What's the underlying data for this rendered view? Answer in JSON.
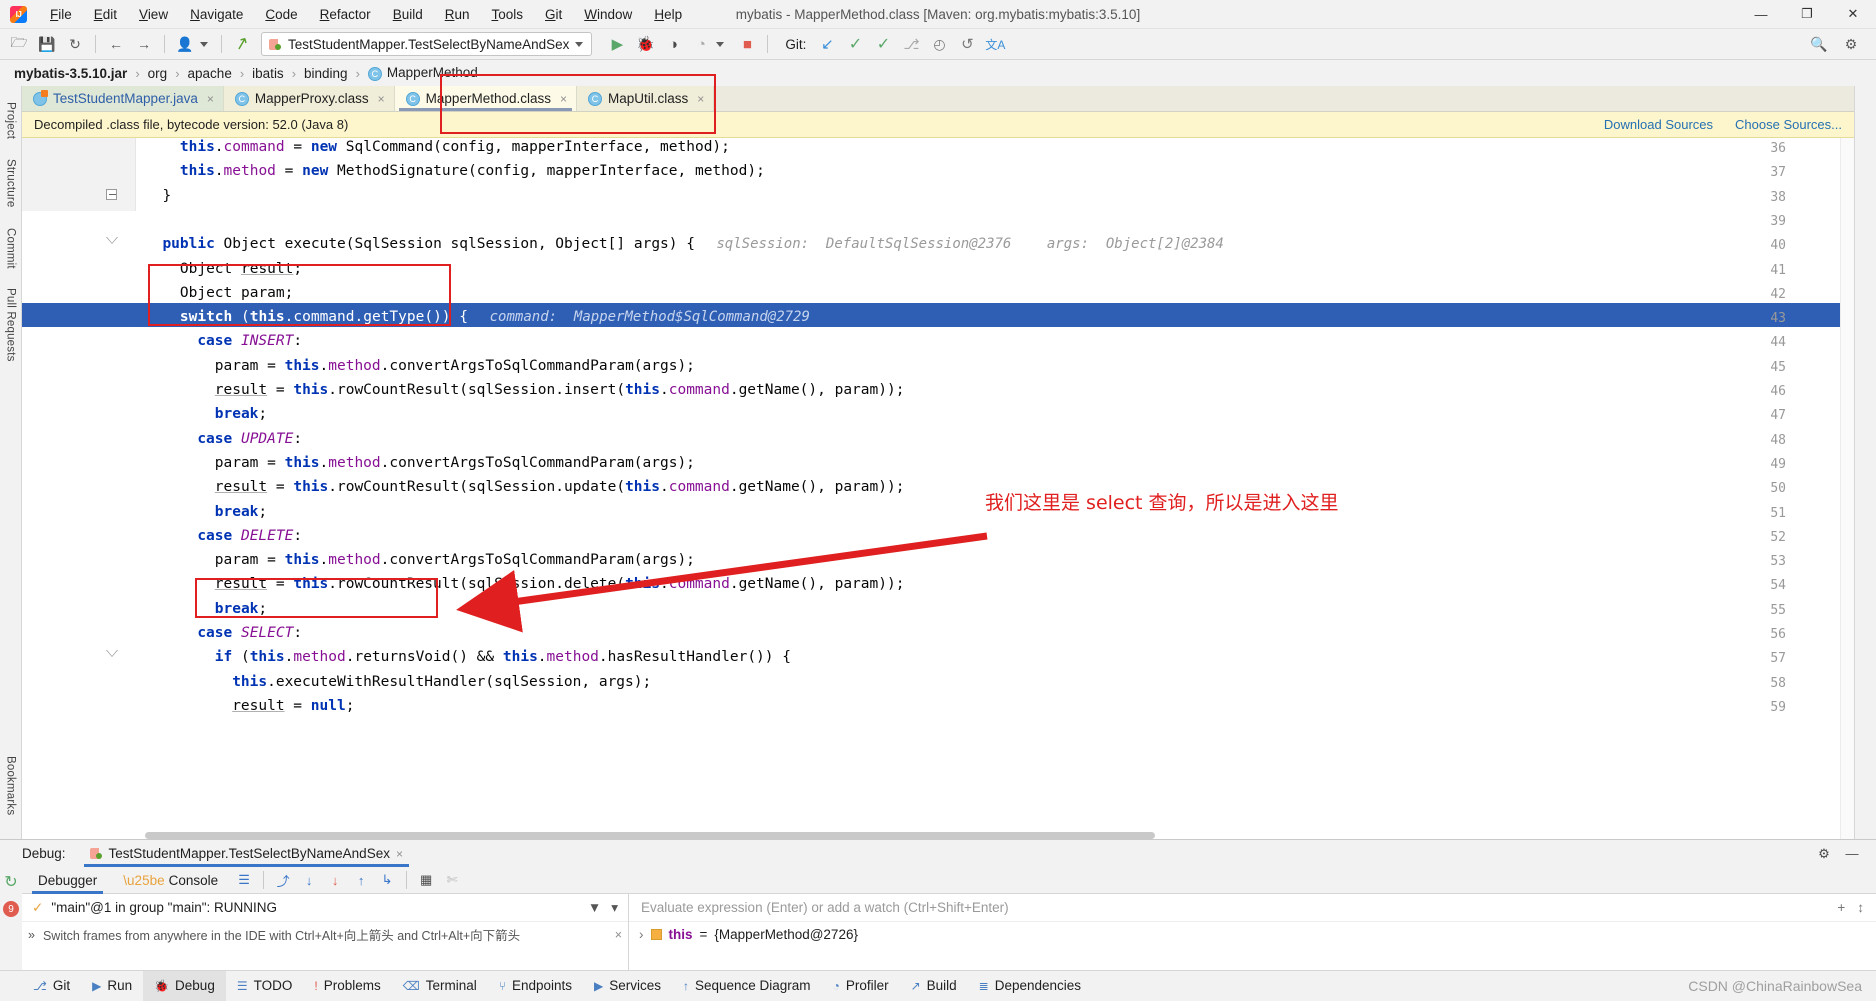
{
  "window": {
    "title": "mybatis - MapperMethod.class [Maven: org.mybatis:mybatis:3.5.10]",
    "minimize": "—",
    "maximize": "❐",
    "close": "✕",
    "app_logo_name": "intellij-idea-logo"
  },
  "menubar": [
    {
      "label": "File"
    },
    {
      "label": "Edit"
    },
    {
      "label": "View"
    },
    {
      "label": "Navigate"
    },
    {
      "label": "Code"
    },
    {
      "label": "Refactor"
    },
    {
      "label": "Build"
    },
    {
      "label": "Run"
    },
    {
      "label": "Tools"
    },
    {
      "label": "Git"
    },
    {
      "label": "Window"
    },
    {
      "label": "Help"
    }
  ],
  "toolbar": {
    "icons_left": [
      {
        "name": "open-folder-icon",
        "glyph": "🗁"
      },
      {
        "name": "save-all-icon",
        "glyph": "💾"
      },
      {
        "name": "sync-refresh-icon",
        "glyph": "↻"
      },
      {
        "name": "back-arrow-icon",
        "glyph": "←"
      },
      {
        "name": "forward-arrow-icon",
        "glyph": "→"
      },
      {
        "name": "profile-user-icon",
        "glyph": "👤"
      },
      {
        "name": "build-hammer-icon",
        "glyph": "↗"
      }
    ],
    "run_config": {
      "label": "TestStudentMapper.TestSelectByNameAndSex",
      "dropdown": "▾"
    },
    "run_button": "▶",
    "debug_button": "🐞",
    "coverage_button": "◑",
    "profile_button": "◔",
    "stop_button": "■",
    "git_label": "Git:",
    "git_update": "↙",
    "git_commit": "✓",
    "git_push": "✓",
    "git_branch": "⎇",
    "git_history": "◴",
    "git_revert": "↺",
    "translate_icon": "文A",
    "search_icon": "🔍",
    "settings_icon": "⚙"
  },
  "breadcrumb": {
    "separator": "›",
    "items": [
      {
        "label": "mybatis-3.5.10.jar",
        "root": true
      },
      {
        "label": "org"
      },
      {
        "label": "apache"
      },
      {
        "label": "ibatis"
      },
      {
        "label": "binding"
      },
      {
        "label": "MapperMethod",
        "badge": "C"
      }
    ]
  },
  "rails": {
    "left": [
      {
        "label": "Project",
        "name": "tool-window-project"
      },
      {
        "label": "Structure",
        "name": "tool-window-structure"
      },
      {
        "label": "Commit",
        "name": "tool-window-commit"
      },
      {
        "label": "Pull Requests",
        "name": "tool-window-pull-requests"
      },
      {
        "label": "Bookmarks",
        "name": "tool-window-bookmarks"
      }
    ]
  },
  "editor_tabs": [
    {
      "label": "TestStudentMapper.java",
      "icon": "java-file-icon",
      "close": "×",
      "active": false,
      "kind": "java"
    },
    {
      "label": "MapperProxy.class",
      "icon": "class-file-icon",
      "close": "×",
      "active": false,
      "kind": "cls"
    },
    {
      "label": "MapperMethod.class",
      "icon": "class-file-icon",
      "close": "×",
      "active": true,
      "kind": "cls"
    },
    {
      "label": "MapUtil.class",
      "icon": "class-file-icon",
      "close": "×",
      "active": false,
      "kind": "cls"
    }
  ],
  "notification": {
    "text": "Decompiled .class file, bytecode version: 52.0 (Java 8)",
    "download_sources": "Download Sources",
    "choose_sources": "Choose Sources..."
  },
  "code": {
    "lines": [
      {
        "n": "36",
        "indent": 4,
        "html": "<span class=\"kw\">this</span>.<span class=\"fld\">command</span> = <span class=\"kw\">new</span> SqlCommand(config, mapperInterface, method);",
        "clipped": true
      },
      {
        "n": "37",
        "indent": 4,
        "html": "<span class=\"kw\">this</span>.<span class=\"fld\">method</span> = <span class=\"kw\">new</span> MethodSignature(config, mapperInterface, method);"
      },
      {
        "n": "38",
        "indent": 2,
        "html": "}",
        "fold": "minus"
      },
      {
        "n": "39",
        "indent": 0,
        "html": ""
      },
      {
        "n": "40",
        "indent": 2,
        "html": "<span class=\"kw\">public</span> Object execute(SqlSession sqlSession, Object[] args) {",
        "fold": "tri",
        "hint": "sqlSession:  DefaultSqlSession@2376",
        "hint2": "args:  Object[2]@2384"
      },
      {
        "n": "41",
        "indent": 4,
        "html": "Object <span class=\"und\">result</span>;"
      },
      {
        "n": "42",
        "indent": 4,
        "html": "Object param;"
      },
      {
        "n": "43",
        "indent": 4,
        "html": "<span class=\"kw\">switch</span> (<span class=\"kw\">this</span>.<span class=\"fld\">command</span>.getType()) {",
        "highlight": true,
        "breakpoint": true,
        "hint": "command:  MapperMethod$SqlCommand@2729"
      },
      {
        "n": "44",
        "indent": 6,
        "html": "<span class=\"kw\">case</span> <span class=\"stat\">INSERT</span>:"
      },
      {
        "n": "45",
        "indent": 8,
        "html": "param = <span class=\"kw\">this</span>.<span class=\"fld\">method</span>.convertArgsToSqlCommandParam(args);"
      },
      {
        "n": "46",
        "indent": 8,
        "html": "<span class=\"und\">result</span> = <span class=\"kw\">this</span>.rowCountResult(sqlSession.insert(<span class=\"kw\">this</span>.<span class=\"fld\">command</span>.getName(), param));"
      },
      {
        "n": "47",
        "indent": 8,
        "html": "<span class=\"kw\">break</span>;"
      },
      {
        "n": "48",
        "indent": 6,
        "html": "<span class=\"kw\">case</span> <span class=\"stat\">UPDATE</span>:"
      },
      {
        "n": "49",
        "indent": 8,
        "html": "param = <span class=\"kw\">this</span>.<span class=\"fld\">method</span>.convertArgsToSqlCommandParam(args);"
      },
      {
        "n": "50",
        "indent": 8,
        "html": "<span class=\"und\">result</span> = <span class=\"kw\">this</span>.rowCountResult(sqlSession.update(<span class=\"kw\">this</span>.<span class=\"fld\">command</span>.getName(), param));"
      },
      {
        "n": "51",
        "indent": 8,
        "html": "<span class=\"kw\">break</span>;"
      },
      {
        "n": "52",
        "indent": 6,
        "html": "<span class=\"kw\">case</span> <span class=\"stat\">DELETE</span>:"
      },
      {
        "n": "53",
        "indent": 8,
        "html": "param = <span class=\"kw\">this</span>.<span class=\"fld\">method</span>.convertArgsToSqlCommandParam(args);"
      },
      {
        "n": "54",
        "indent": 8,
        "html": "<span class=\"und\">result</span> = <span class=\"kw\">this</span>.rowCountResult(sqlSession.delete(<span class=\"kw\">this</span>.<span class=\"fld\">command</span>.getName(), param));"
      },
      {
        "n": "55",
        "indent": 8,
        "html": "<span class=\"kw\">break</span>;"
      },
      {
        "n": "56",
        "indent": 6,
        "html": "<span class=\"kw\">case</span> <span class=\"stat\">SELECT</span>:"
      },
      {
        "n": "57",
        "indent": 8,
        "html": "<span class=\"kw\">if</span> (<span class=\"kw\">this</span>.<span class=\"fld\">method</span>.returnsVoid() &amp;&amp; <span class=\"kw\">this</span>.<span class=\"fld\">method</span>.hasResultHandler()) {",
        "fold": "tri"
      },
      {
        "n": "58",
        "indent": 10,
        "html": "<span class=\"kw\">this</span>.executeWithResultHandler(sqlSession, args);"
      },
      {
        "n": "59",
        "indent": 10,
        "html": "<span class=\"und\">result</span> = <span class=\"kw\">null</span>;",
        "clipped": true
      }
    ]
  },
  "annotation": {
    "caption": "我们这里是 select 查询，所以是进入这里",
    "color": "#e02020"
  },
  "debug": {
    "header_label": "Debug:",
    "session_name": "TestStudentMapper.TestSelectByNameAndSex",
    "session_close": "×",
    "settings_icon": "⚙",
    "minimize_icon": "—",
    "rerun_icon": "↻",
    "mute_breakpoints_icon": "9",
    "tabs": [
      {
        "label": "Debugger",
        "active": true
      },
      {
        "label": "Console",
        "active": false
      }
    ],
    "toolbar_icons": [
      {
        "name": "layout-settings-icon",
        "glyph": "☰"
      },
      {
        "name": "step-over-icon",
        "glyph": "⤴"
      },
      {
        "name": "step-into-icon",
        "glyph": "↓"
      },
      {
        "name": "force-step-into-icon",
        "glyph": "↓"
      },
      {
        "name": "step-out-icon",
        "glyph": "↑"
      },
      {
        "name": "run-to-cursor-icon",
        "glyph": "↳"
      },
      {
        "name": "evaluate-expression-icon",
        "glyph": "▦"
      },
      {
        "name": "mute-breakpoints-icon",
        "glyph": "✄"
      }
    ],
    "thread": {
      "status_icon": "✓",
      "text": "\"main\"@1 in group \"main\": RUNNING",
      "filter_icon": "▼",
      "dropdown_icon": "▾"
    },
    "frames_hint": {
      "expand": "»",
      "text": "Switch frames from anywhere in the IDE with Ctrl+Alt+向上箭头 and Ctrl+Alt+向下箭头",
      "close": "×"
    },
    "evaluate_placeholder": "Evaluate expression (Enter) or add a watch (Ctrl+Shift+Enter)",
    "add_watch_icon": "+",
    "watch_sort_icon": "↕",
    "variables": [
      {
        "expand": "›",
        "name": "this",
        "eq": "=",
        "value": "{MapperMethod@2726}"
      }
    ]
  },
  "statusbar": {
    "items": [
      {
        "label": "Git",
        "icon": "git-branch-icon",
        "glyph": "⎇",
        "active": false
      },
      {
        "label": "Run",
        "icon": "run-icon",
        "glyph": "▶",
        "active": false
      },
      {
        "label": "Debug",
        "icon": "debug-icon",
        "glyph": "🐞",
        "active": true
      },
      {
        "label": "TODO",
        "icon": "todo-icon",
        "glyph": "☰",
        "active": false
      },
      {
        "label": "Problems",
        "icon": "problems-icon",
        "glyph": "!",
        "active": false
      },
      {
        "label": "Terminal",
        "icon": "terminal-icon",
        "glyph": "⌫",
        "active": false
      },
      {
        "label": "Endpoints",
        "icon": "endpoints-icon",
        "glyph": "⑂",
        "active": false
      },
      {
        "label": "Services",
        "icon": "services-icon",
        "glyph": "▶",
        "active": false
      },
      {
        "label": "Sequence Diagram",
        "icon": "sequence-diagram-icon",
        "glyph": "↑",
        "active": false
      },
      {
        "label": "Profiler",
        "icon": "profiler-icon",
        "glyph": "◔",
        "active": false
      },
      {
        "label": "Build",
        "icon": "build-hammer-icon",
        "glyph": "↗",
        "active": false
      },
      {
        "label": "Dependencies",
        "icon": "dependencies-icon",
        "glyph": "≣",
        "active": false
      }
    ],
    "watermark": "CSDN @ChinaRainbowSea"
  }
}
